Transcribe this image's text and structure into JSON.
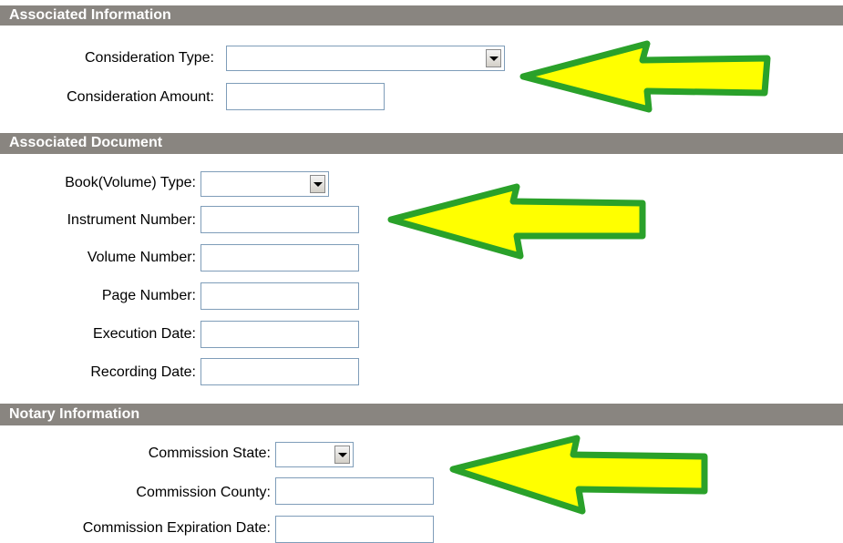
{
  "sections": {
    "associated_information": {
      "title": "Associated Information",
      "consideration_type": {
        "label": "Consideration Type:",
        "value": ""
      },
      "consideration_amount": {
        "label": "Consideration Amount:",
        "value": ""
      }
    },
    "associated_document": {
      "title": "Associated Document",
      "book_volume_type": {
        "label": "Book(Volume) Type:",
        "value": ""
      },
      "instrument_number": {
        "label": "Instrument Number:",
        "value": ""
      },
      "volume_number": {
        "label": "Volume Number:",
        "value": ""
      },
      "page_number": {
        "label": "Page Number:",
        "value": ""
      },
      "execution_date": {
        "label": "Execution Date:",
        "value": ""
      },
      "recording_date": {
        "label": "Recording Date:",
        "value": ""
      }
    },
    "notary_information": {
      "title": "Notary Information",
      "commission_state": {
        "label": "Commission State:",
        "value": ""
      },
      "commission_county": {
        "label": "Commission County:",
        "value": ""
      },
      "commission_expiration_date": {
        "label": "Commission Expiration Date:",
        "value": ""
      }
    }
  },
  "annotation": {
    "arrow_fill": "#ffff00",
    "arrow_stroke": "#2aa12a"
  }
}
